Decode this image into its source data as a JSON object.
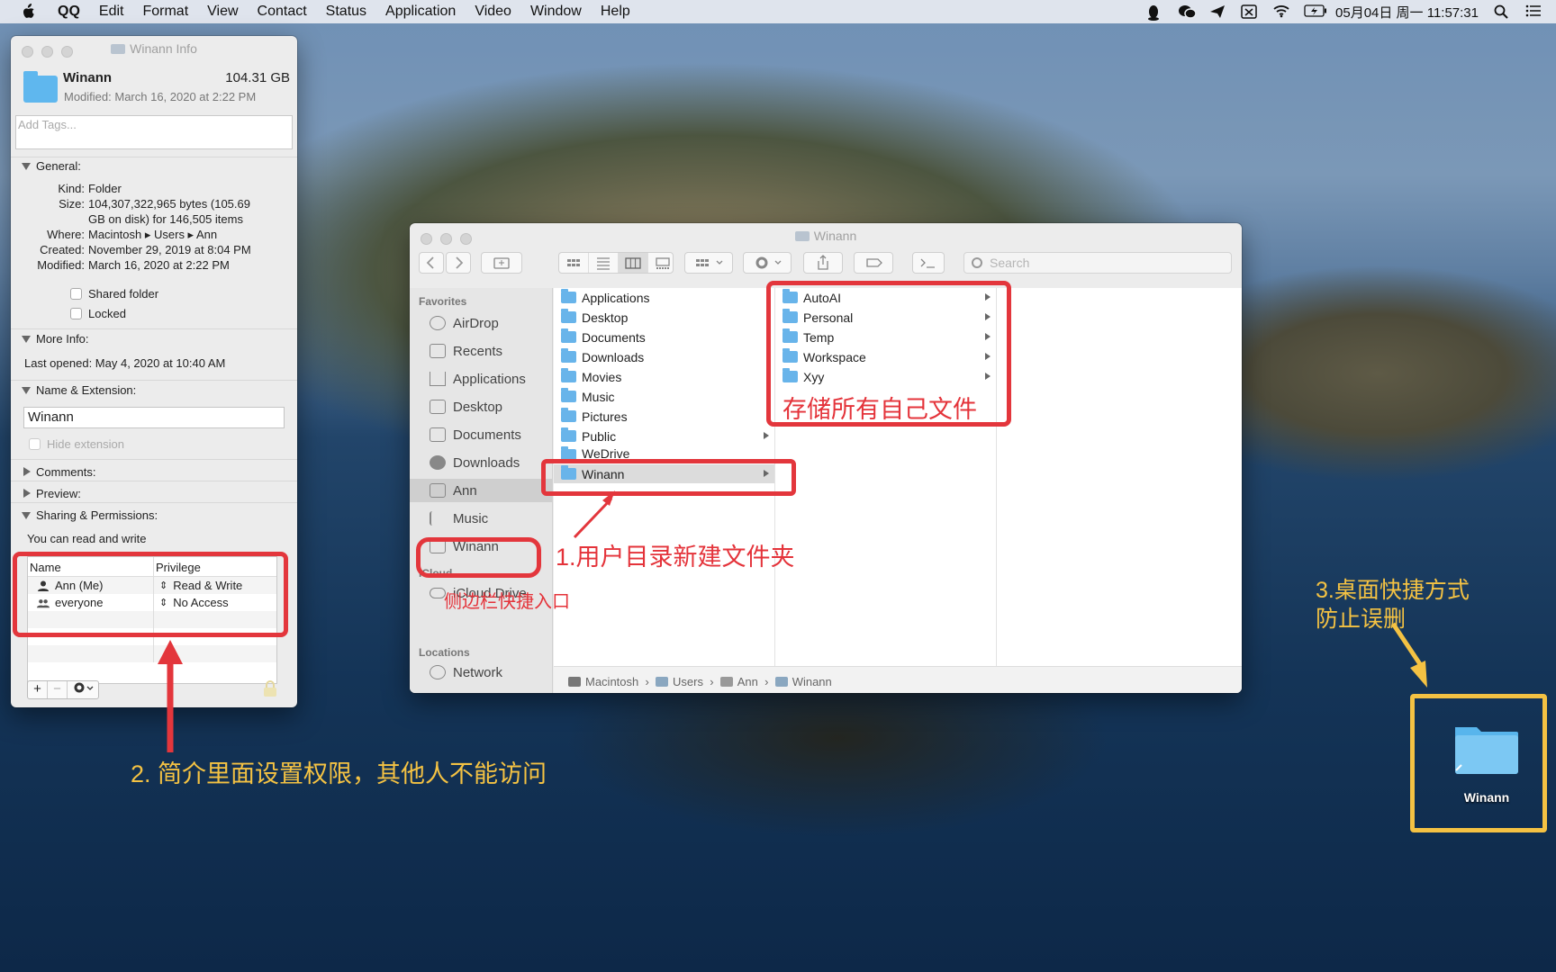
{
  "menubar": {
    "app": "QQ",
    "items": [
      "Edit",
      "Format",
      "View",
      "Contact",
      "Status",
      "Application",
      "Video",
      "Window",
      "Help"
    ],
    "clock": "05月04日 周一 11:57:31"
  },
  "info": {
    "title": "Winann Info",
    "name": "Winann",
    "size": "104.31 GB",
    "modified": "Modified: March 16, 2020 at 2:22 PM",
    "tags_placeholder": "Add Tags...",
    "general_label": "General:",
    "kind_k": "Kind:",
    "kind_v": "Folder",
    "size_k": "Size:",
    "size_v1": "104,307,322,965 bytes (105.69",
    "size_v2": "GB on disk) for 146,505 items",
    "where_k": "Where:",
    "where_v": "Macintosh ▸ Users ▸ Ann",
    "created_k": "Created:",
    "created_v": "November 29, 2019 at 8:04 PM",
    "mod_k": "Modified:",
    "mod_v": "March 16, 2020 at 2:22 PM",
    "shared": "Shared folder",
    "locked": "Locked",
    "more_info": "More Info:",
    "last_opened": "Last opened: May 4, 2020 at 10:40 AM",
    "name_ext": "Name & Extension:",
    "name_value": "Winann",
    "hide_ext": "Hide extension",
    "comments": "Comments:",
    "preview": "Preview:",
    "sharing": "Sharing & Permissions:",
    "can_rw": "You can read and write",
    "perm_head": [
      "Name",
      "Privilege"
    ],
    "perms": [
      {
        "name": "Ann (Me)",
        "priv": "Read & Write"
      },
      {
        "name": "everyone",
        "priv": "No Access"
      }
    ]
  },
  "finder": {
    "title": "Winann",
    "search_placeholder": "Search",
    "sidebar": {
      "favorites": "Favorites",
      "items": [
        "AirDrop",
        "Recents",
        "Applications",
        "Desktop",
        "Documents",
        "Downloads",
        "Ann",
        "Music",
        "Winann"
      ],
      "icloud": "iCloud",
      "icloud_drive": "iCloud Drive",
      "locations": "Locations",
      "network": "Network"
    },
    "col1": [
      "Applications",
      "Desktop",
      "Documents",
      "Downloads",
      "Movies",
      "Music",
      "Pictures",
      "Public",
      "WeDrive",
      "Winann"
    ],
    "col2": [
      "AutoAI",
      "Personal",
      "Temp",
      "Workspace",
      "Xyy"
    ],
    "path": [
      "Macintosh",
      "Users",
      "Ann",
      "Winann"
    ]
  },
  "desktop": {
    "icon_label": "Winann"
  },
  "annotations": {
    "a1": "1.用户目录新建文件夹",
    "a1b": "侧边栏快捷入口",
    "store": "存储所有自己文件",
    "a2": "2. 简介里面设置权限，其他人不能访问",
    "a3a": "3.桌面快捷方式",
    "a3b": "防止误删"
  },
  "colors": {
    "annotation_red": "#e3363c",
    "annotation_yellow": "#f4c243",
    "folder_blue": "#5fb7ee"
  }
}
